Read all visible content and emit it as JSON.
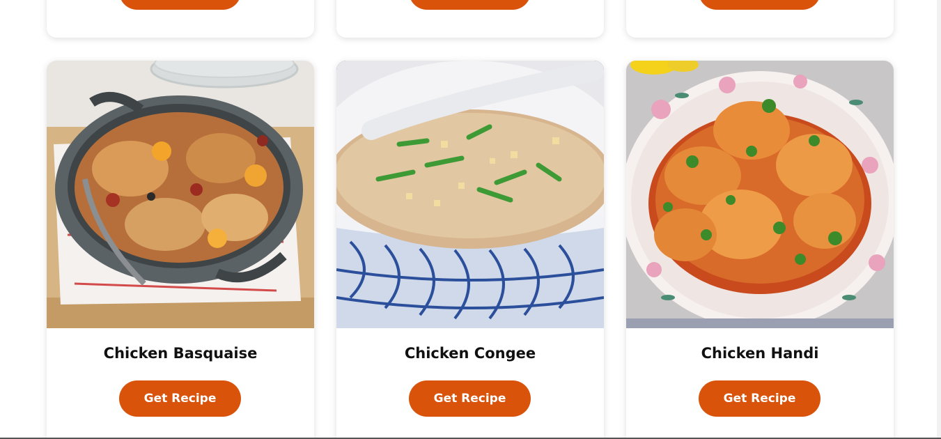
{
  "recipes_top": [
    {
      "button_label": ""
    },
    {
      "button_label": ""
    },
    {
      "button_label": ""
    }
  ],
  "recipes": [
    {
      "title": "Chicken Basquaise",
      "button_label": "Get Recipe"
    },
    {
      "title": "Chicken Congee",
      "button_label": "Get Recipe"
    },
    {
      "title": "Chicken Handi",
      "button_label": "Get Recipe"
    }
  ],
  "colors": {
    "accent": "#d9530b",
    "background": "#ffffff"
  }
}
